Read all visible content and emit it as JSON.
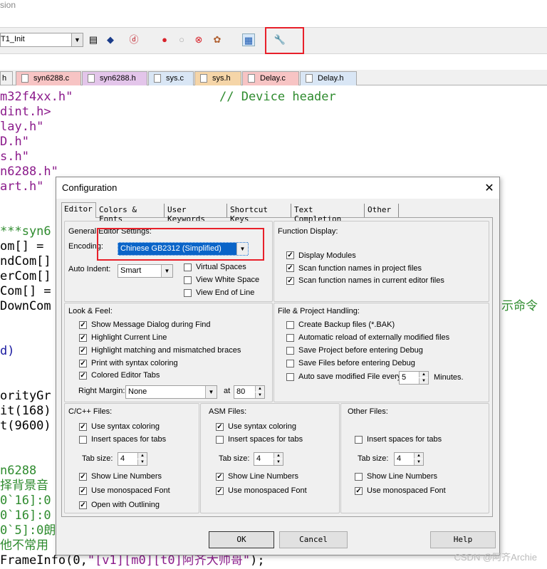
{
  "window": {
    "title_fragment": "sion"
  },
  "toolbar": {
    "target_value": "T1_Init"
  },
  "file_tabs": [
    {
      "label": "h",
      "color": "#f5d0a0"
    },
    {
      "label": "syn6288.c",
      "color": "#f7c4c4"
    },
    {
      "label": "syn6288.h",
      "color": "#e3c5ea"
    },
    {
      "label": "sys.c",
      "color": "#d9e6f5"
    },
    {
      "label": "sys.h",
      "color": "#f5d5a8"
    },
    {
      "label": "Delay.c",
      "color": "#f7c4c4"
    },
    {
      "label": "Delay.h",
      "color": "#d9e6f5"
    }
  ],
  "code": {
    "l1a": "m32f4xx.h\"",
    "l1c": "// Device header",
    "l2": "dint.h>",
    "l3": "lay.h\"",
    "l4": "D.h\"",
    "l5": "s.h\"",
    "l6": "n6288.h\"",
    "l7": "art.h\"",
    "l8": "***syn6",
    "l9": "om[] =",
    "l10": "ndCom[]",
    "l11": "erCom[]",
    "l12": "Com[] =",
    "l13": "DownCom",
    "l13r": "示命令",
    "l14": "d)",
    "l15": "orityGr",
    "l16": "it(168)",
    "l17": "t(9600)",
    "l18": "n6288",
    "l19": "择背景音",
    "l20": "0`16]:0",
    "l21": "0`16]:0",
    "l22": "0`5]:0朗",
    "l23": "他不常用",
    "l24a": "FrameInfo(0,",
    "l24b": "\"[v1][m0][t0]阿齐大帅哥\"",
    "l24c": ");"
  },
  "dialog": {
    "title": "Configuration",
    "close_glyph": "✕",
    "tabs": [
      "Editor",
      "Colors & Fonts",
      "User Keywords",
      "Shortcut Keys",
      "Text Completion",
      "Other"
    ],
    "general": {
      "heading": "General Editor Settings:",
      "encoding_label": "Encoding:",
      "encoding_value": "Chinese GB2312 (Simplified)",
      "auto_indent_label": "Auto Indent:",
      "auto_indent_value": "Smart",
      "virtual_spaces": "Virtual Spaces",
      "view_white_space": "View White Space",
      "view_end_of_line": "View End of Line"
    },
    "function_display": {
      "heading": "Function Display:",
      "display_modules": "Display Modules",
      "scan_project": "Scan function names in project files",
      "scan_current": "Scan function names in current editor files"
    },
    "look_feel": {
      "heading": "Look & Feel:",
      "items": [
        "Show Message Dialog during Find",
        "Highlight Current Line",
        "Highlight matching and mismatched braces",
        "Print with syntax coloring",
        "Colored Editor Tabs"
      ],
      "right_margin_label": "Right Margin:",
      "right_margin_value": "None",
      "at_label": "at",
      "at_value": "80"
    },
    "file_project": {
      "heading": "File & Project Handling:",
      "items": [
        "Create Backup files (*.BAK)",
        "Automatic reload of externally modified files",
        "Save Project before entering Debug",
        "Save Files before entering Debug",
        "Auto save modified File every"
      ],
      "minutes_value": "5",
      "minutes_label": "Minutes."
    },
    "c_files": {
      "heading": "C/C++ Files:",
      "syntax": "Use syntax coloring",
      "spaces": "Insert spaces for tabs",
      "tab_size_label": "Tab size:",
      "tab_size": "4",
      "line_numbers": "Show Line Numbers",
      "mono": "Use monospaced Font",
      "outlining": "Open with Outlining"
    },
    "asm_files": {
      "heading": "ASM Files:",
      "syntax": "Use syntax coloring",
      "spaces": "Insert spaces for tabs",
      "tab_size_label": "Tab size:",
      "tab_size": "4",
      "line_numbers": "Show Line Numbers",
      "mono": "Use monospaced Font"
    },
    "other_files": {
      "heading": "Other Files:",
      "spaces": "Insert spaces for tabs",
      "tab_size_label": "Tab size:",
      "tab_size": "4",
      "line_numbers": "Show Line Numbers",
      "mono": "Use monospaced Font"
    },
    "buttons": {
      "ok": "OK",
      "cancel": "Cancel",
      "help": "Help"
    }
  },
  "watermark": "CSDN @阿齐Archie"
}
